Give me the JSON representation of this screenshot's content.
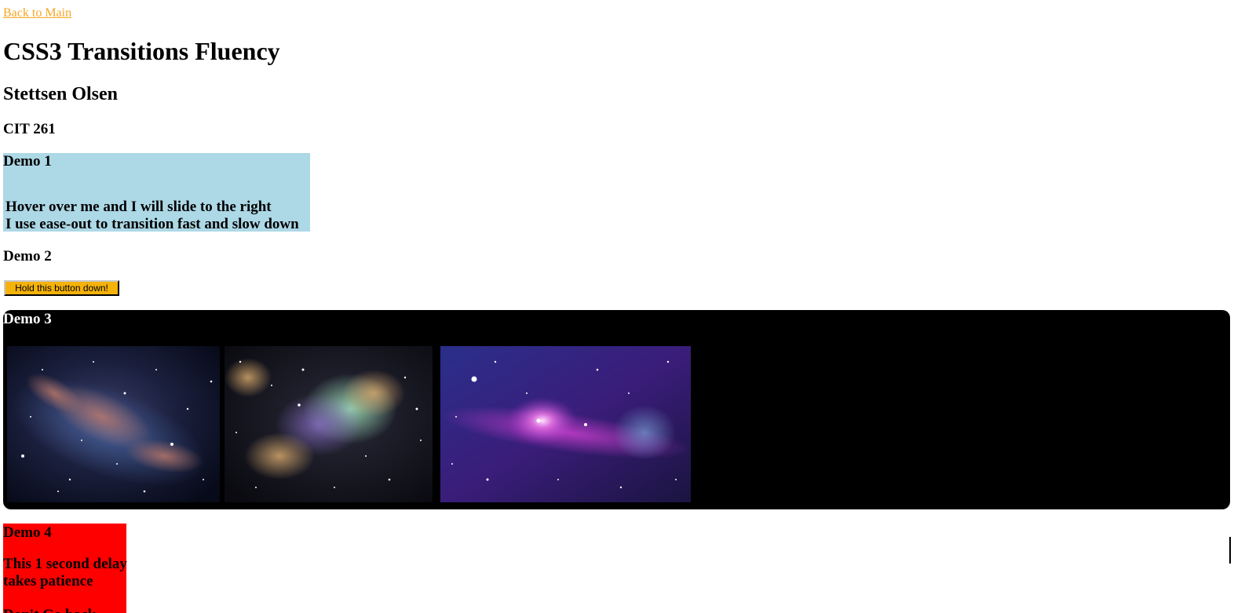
{
  "nav": {
    "back_label": "Back to Main"
  },
  "header": {
    "title": "CSS3 Transitions Fluency",
    "author": "Stettsen Olsen",
    "course": "CIT 261"
  },
  "demo1": {
    "heading": "Demo 1",
    "line1": "Hover over me and I will slide to the right",
    "line2": "I use ease-out to transition fast and slow down",
    "background": "#add8e6"
  },
  "demo2": {
    "heading": "Demo 2",
    "button_label": "Hold this button down!",
    "button_color": "#f5b20a"
  },
  "demo3": {
    "heading": "Demo 3",
    "background": "#000000",
    "images": [
      {
        "name": "galaxy-image-1"
      },
      {
        "name": "nebula-image-2"
      },
      {
        "name": "purple-nebula-image-3"
      }
    ]
  },
  "demo4": {
    "heading": "Demo 4",
    "text": "This 1 second delay takes patience",
    "cut_text": "Don't Go back",
    "background": "#ff0000"
  },
  "colors": {
    "link": "#f5a623"
  }
}
